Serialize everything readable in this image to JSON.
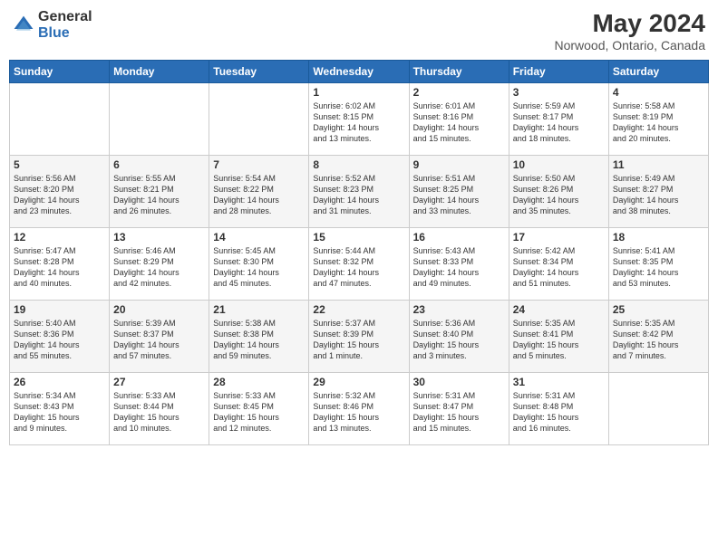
{
  "logo": {
    "general": "General",
    "blue": "Blue"
  },
  "title": "May 2024",
  "subtitle": "Norwood, Ontario, Canada",
  "days_of_week": [
    "Sunday",
    "Monday",
    "Tuesday",
    "Wednesday",
    "Thursday",
    "Friday",
    "Saturday"
  ],
  "weeks": [
    [
      {
        "day": "",
        "info": ""
      },
      {
        "day": "",
        "info": ""
      },
      {
        "day": "",
        "info": ""
      },
      {
        "day": "1",
        "info": "Sunrise: 6:02 AM\nSunset: 8:15 PM\nDaylight: 14 hours\nand 13 minutes."
      },
      {
        "day": "2",
        "info": "Sunrise: 6:01 AM\nSunset: 8:16 PM\nDaylight: 14 hours\nand 15 minutes."
      },
      {
        "day": "3",
        "info": "Sunrise: 5:59 AM\nSunset: 8:17 PM\nDaylight: 14 hours\nand 18 minutes."
      },
      {
        "day": "4",
        "info": "Sunrise: 5:58 AM\nSunset: 8:19 PM\nDaylight: 14 hours\nand 20 minutes."
      }
    ],
    [
      {
        "day": "5",
        "info": "Sunrise: 5:56 AM\nSunset: 8:20 PM\nDaylight: 14 hours\nand 23 minutes."
      },
      {
        "day": "6",
        "info": "Sunrise: 5:55 AM\nSunset: 8:21 PM\nDaylight: 14 hours\nand 26 minutes."
      },
      {
        "day": "7",
        "info": "Sunrise: 5:54 AM\nSunset: 8:22 PM\nDaylight: 14 hours\nand 28 minutes."
      },
      {
        "day": "8",
        "info": "Sunrise: 5:52 AM\nSunset: 8:23 PM\nDaylight: 14 hours\nand 31 minutes."
      },
      {
        "day": "9",
        "info": "Sunrise: 5:51 AM\nSunset: 8:25 PM\nDaylight: 14 hours\nand 33 minutes."
      },
      {
        "day": "10",
        "info": "Sunrise: 5:50 AM\nSunset: 8:26 PM\nDaylight: 14 hours\nand 35 minutes."
      },
      {
        "day": "11",
        "info": "Sunrise: 5:49 AM\nSunset: 8:27 PM\nDaylight: 14 hours\nand 38 minutes."
      }
    ],
    [
      {
        "day": "12",
        "info": "Sunrise: 5:47 AM\nSunset: 8:28 PM\nDaylight: 14 hours\nand 40 minutes."
      },
      {
        "day": "13",
        "info": "Sunrise: 5:46 AM\nSunset: 8:29 PM\nDaylight: 14 hours\nand 42 minutes."
      },
      {
        "day": "14",
        "info": "Sunrise: 5:45 AM\nSunset: 8:30 PM\nDaylight: 14 hours\nand 45 minutes."
      },
      {
        "day": "15",
        "info": "Sunrise: 5:44 AM\nSunset: 8:32 PM\nDaylight: 14 hours\nand 47 minutes."
      },
      {
        "day": "16",
        "info": "Sunrise: 5:43 AM\nSunset: 8:33 PM\nDaylight: 14 hours\nand 49 minutes."
      },
      {
        "day": "17",
        "info": "Sunrise: 5:42 AM\nSunset: 8:34 PM\nDaylight: 14 hours\nand 51 minutes."
      },
      {
        "day": "18",
        "info": "Sunrise: 5:41 AM\nSunset: 8:35 PM\nDaylight: 14 hours\nand 53 minutes."
      }
    ],
    [
      {
        "day": "19",
        "info": "Sunrise: 5:40 AM\nSunset: 8:36 PM\nDaylight: 14 hours\nand 55 minutes."
      },
      {
        "day": "20",
        "info": "Sunrise: 5:39 AM\nSunset: 8:37 PM\nDaylight: 14 hours\nand 57 minutes."
      },
      {
        "day": "21",
        "info": "Sunrise: 5:38 AM\nSunset: 8:38 PM\nDaylight: 14 hours\nand 59 minutes."
      },
      {
        "day": "22",
        "info": "Sunrise: 5:37 AM\nSunset: 8:39 PM\nDaylight: 15 hours\nand 1 minute."
      },
      {
        "day": "23",
        "info": "Sunrise: 5:36 AM\nSunset: 8:40 PM\nDaylight: 15 hours\nand 3 minutes."
      },
      {
        "day": "24",
        "info": "Sunrise: 5:35 AM\nSunset: 8:41 PM\nDaylight: 15 hours\nand 5 minutes."
      },
      {
        "day": "25",
        "info": "Sunrise: 5:35 AM\nSunset: 8:42 PM\nDaylight: 15 hours\nand 7 minutes."
      }
    ],
    [
      {
        "day": "26",
        "info": "Sunrise: 5:34 AM\nSunset: 8:43 PM\nDaylight: 15 hours\nand 9 minutes."
      },
      {
        "day": "27",
        "info": "Sunrise: 5:33 AM\nSunset: 8:44 PM\nDaylight: 15 hours\nand 10 minutes."
      },
      {
        "day": "28",
        "info": "Sunrise: 5:33 AM\nSunset: 8:45 PM\nDaylight: 15 hours\nand 12 minutes."
      },
      {
        "day": "29",
        "info": "Sunrise: 5:32 AM\nSunset: 8:46 PM\nDaylight: 15 hours\nand 13 minutes."
      },
      {
        "day": "30",
        "info": "Sunrise: 5:31 AM\nSunset: 8:47 PM\nDaylight: 15 hours\nand 15 minutes."
      },
      {
        "day": "31",
        "info": "Sunrise: 5:31 AM\nSunset: 8:48 PM\nDaylight: 15 hours\nand 16 minutes."
      },
      {
        "day": "",
        "info": ""
      }
    ]
  ]
}
